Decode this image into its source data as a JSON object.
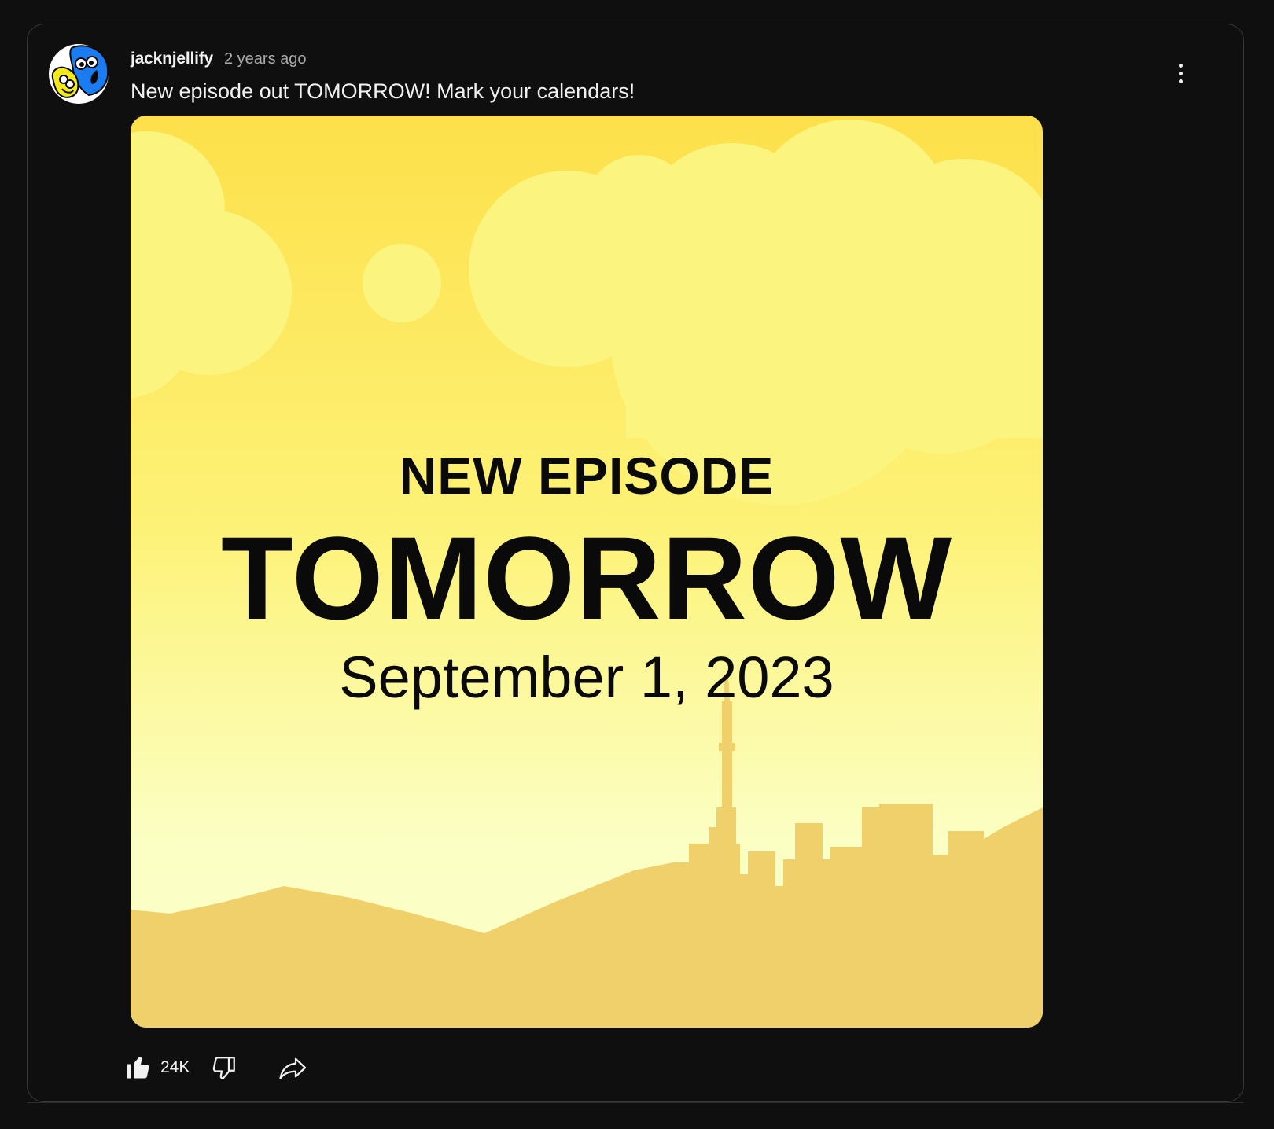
{
  "post": {
    "author": "jacknjellify",
    "timestamp": "2 years ago",
    "text": "New episode out TOMORROW! Mark your calendars!",
    "image": {
      "line1": "NEW EPISODE",
      "line2": "TOMORROW",
      "line3": "September 1, 2023",
      "colors": {
        "sky_top": "#fde04a",
        "sky_bottom": "#fbffc4",
        "clouds": "#fbf57f",
        "ground": "#efd06a"
      }
    },
    "likes": "24K"
  },
  "icons": {
    "menu": "more-vert-icon",
    "like": "thumb-up-icon",
    "dislike": "thumb-down-icon",
    "share": "share-icon"
  }
}
